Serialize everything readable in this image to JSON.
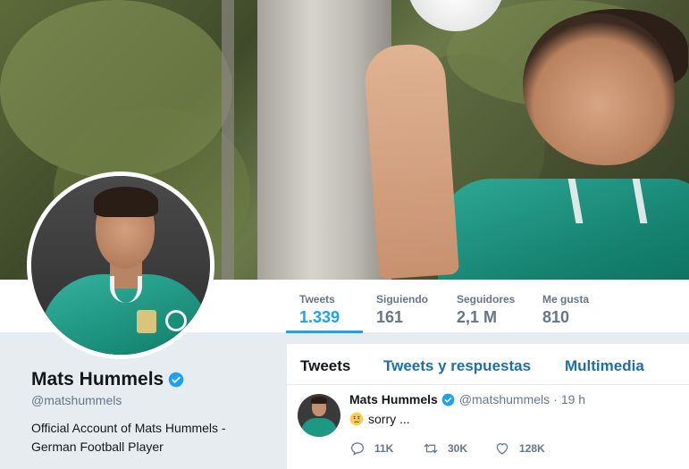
{
  "profile": {
    "name": "Mats Hummels",
    "handle": "@matshummels",
    "bio_line1": "Official Account of Mats Hummels -",
    "bio_line2": "German Football Player"
  },
  "stats": [
    {
      "label": "Tweets",
      "value": "1.339"
    },
    {
      "label": "Siguiendo",
      "value": "161"
    },
    {
      "label": "Seguidores",
      "value": "2,1 M"
    },
    {
      "label": "Me gusta",
      "value": "810"
    }
  ],
  "tabs": [
    {
      "label": "Tweets"
    },
    {
      "label": "Tweets y respuestas"
    },
    {
      "label": "Multimedia"
    }
  ],
  "tweet": {
    "name": "Mats Hummels",
    "handle": "@matshummels",
    "separator": "·",
    "time": "19 h",
    "text": "sorry ...",
    "emoji": "crying-face",
    "replies": "11K",
    "retweets": "30K",
    "likes": "128K"
  },
  "colors": {
    "accent": "#1da1f2",
    "link": "#1d6fa5",
    "muted": "#657786",
    "background": "#e6ecf0"
  }
}
